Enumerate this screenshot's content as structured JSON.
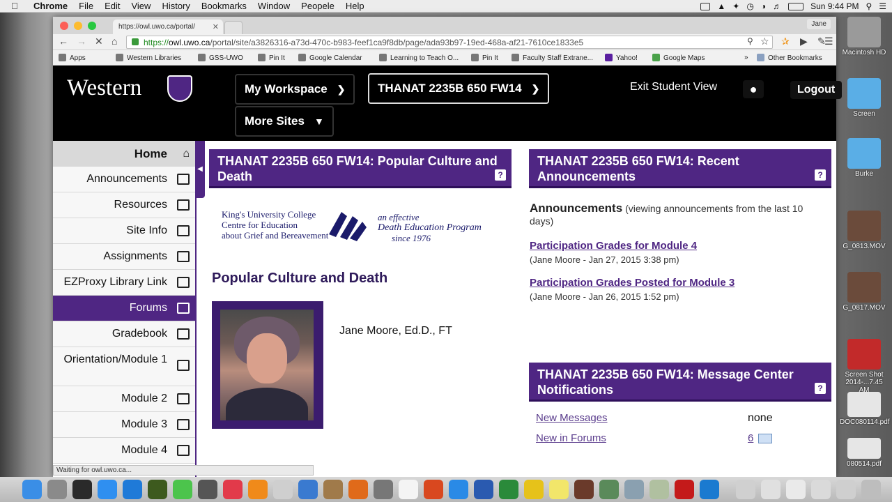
{
  "menubar": {
    "app": "Chrome",
    "menus": [
      "File",
      "Edit",
      "View",
      "History",
      "Bookmarks",
      "Window",
      "Peopele",
      "Help"
    ],
    "clock": "Sun 9:44 PM"
  },
  "desktop": {
    "icons": [
      {
        "label": "Macintosh HD",
        "color": "#9a9a9a"
      },
      {
        "label": "Screen",
        "color": "#5aaee6"
      },
      {
        "label": "Burke",
        "color": "#5aaee6"
      },
      {
        "label": "G_0813.MOV",
        "color": "#6b4b3b"
      },
      {
        "label": "G_0817.MOV",
        "color": "#6b4b3b"
      },
      {
        "label": "Screen Shot 2014-...7.45 AM",
        "color": "#c22a2a"
      },
      {
        "label": "DOC080114.pdf",
        "color": "#e6e6e6"
      },
      {
        "label": "080514.pdf",
        "color": "#e6e6e6"
      }
    ]
  },
  "browser": {
    "tab_title": "https://owl.uwo.ca/portal/",
    "profile": "Jane",
    "url_scheme": "https://",
    "url_host": "owl.uwo.ca",
    "url_path": "/portal/site/a3826316-a73d-470c-b983-feef1ca9f8db/page/ada93b97-19ed-468a-af21-7610ce1833e5",
    "bookmarks": [
      "Apps",
      "Western Libraries",
      "GSS-UWO",
      "Pin It",
      "Google Calendar",
      "Learning to Teach O...",
      "Pin It",
      "Faculty Staff Extrane...",
      "Yahoo!",
      "Google Maps",
      "»",
      "Other Bookmarks"
    ],
    "status": "Waiting for owl.uwo.ca..."
  },
  "header": {
    "logo": "Western",
    "workspace": "My Workspace",
    "site": "THANAT 2235B 650 FW14",
    "more_sites": "More Sites",
    "exit_student_view": "Exit Student View",
    "logout": "Logout"
  },
  "sidebar": {
    "items": [
      {
        "label": "Home"
      },
      {
        "label": "Announcements"
      },
      {
        "label": "Resources"
      },
      {
        "label": "Site Info"
      },
      {
        "label": "Assignments"
      },
      {
        "label": "EZProxy Library Link"
      },
      {
        "label": "Forums"
      },
      {
        "label": "Gradebook"
      },
      {
        "label": "Orientation/Module 1"
      },
      {
        "label": "Module 2"
      },
      {
        "label": "Module 3"
      },
      {
        "label": "Module 4"
      }
    ]
  },
  "overview": {
    "title": "THANAT 2235B 650 FW14: Popular Culture and Death",
    "help": "?",
    "kings_logo": [
      "King's University College",
      "Centre for Education",
      "about Grief and Bereavement"
    ],
    "kings_tag": [
      "an effective",
      "Death Education Program",
      "since 1976"
    ],
    "heading": "Popular Culture and Death",
    "author": "Jane Moore, Ed.D., FT"
  },
  "announcements": {
    "title": "THANAT 2235B 650 FW14: Recent Announcements",
    "help": "?",
    "heading": "Announcements",
    "subheading": "(viewing announcements from the last 10 days)",
    "items": [
      {
        "title": "Participation Grades for Module 4",
        "meta": "(Jane Moore - Jan 27, 2015 3:38 pm)"
      },
      {
        "title": "Participation Grades Posted for Module 3",
        "meta": "(Jane Moore - Jan 26, 2015 1:52 pm)"
      }
    ]
  },
  "messages": {
    "title": "THANAT 2235B 650 FW14: Message Center Notifications",
    "help": "?",
    "new_messages_label": "New Messages",
    "new_messages_value": "none",
    "new_forums_label": "New in Forums",
    "new_forums_value": "6"
  }
}
